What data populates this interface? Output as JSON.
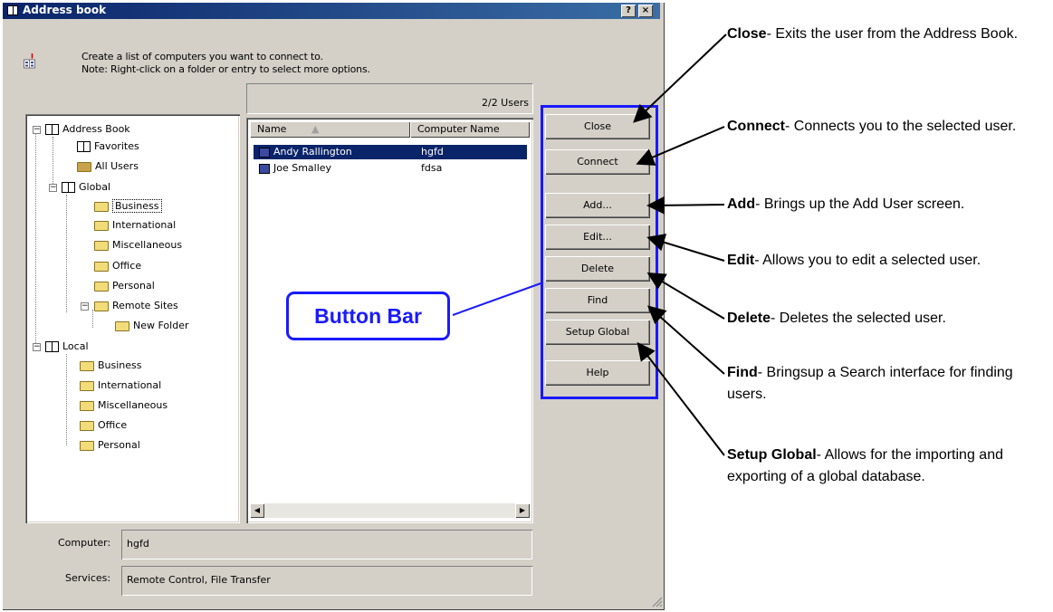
{
  "window": {
    "title": "Address book",
    "help_btn": "?",
    "close_btn": "×",
    "description_line1": "Create a list of computers you want to connect to.",
    "description_line2": "Note: Right-click on a folder or entry to select more options."
  },
  "tree": {
    "root": "Address Book",
    "favorites": "Favorites",
    "all_users": "All Users",
    "global": "Global",
    "global_children": [
      "Business",
      "International",
      "Miscellaneous",
      "Office",
      "Personal",
      "Remote Sites"
    ],
    "remote_new_folder": "New Folder",
    "local": "Local",
    "local_children": [
      "Business",
      "International",
      "Miscellaneous",
      "Office",
      "Personal"
    ]
  },
  "list": {
    "status": "2/2 Users",
    "col_name": "Name",
    "col_computer": "Computer Name",
    "rows": [
      {
        "name": "Andy Rallington",
        "computer": "hgfd",
        "selected": true
      },
      {
        "name": "Joe Smalley",
        "computer": "fdsa",
        "selected": false
      }
    ]
  },
  "buttons": {
    "close": "Close",
    "connect": "Connect",
    "add": "Add...",
    "edit": "Edit...",
    "delete": "Delete",
    "find": "Find",
    "setup_global": "Setup Global",
    "help": "Help"
  },
  "details": {
    "computer_label": "Computer:",
    "computer_value": "hgfd",
    "services_label": "Services:",
    "services_value": "Remote Control, File Transfer"
  },
  "callout": "Button Bar",
  "annotations": [
    {
      "term": "Close",
      "text": "- Exits the user from the Address Book."
    },
    {
      "term": "Connect",
      "text": "- Connects you to the selected user."
    },
    {
      "term": "Add",
      "text": "- Brings up the Add User screen."
    },
    {
      "term": "Edit",
      "text": "- Allows you to edit a selected user."
    },
    {
      "term": "Delete",
      "text": "- Deletes the selected user."
    },
    {
      "term": "Find",
      "text": "- Bringsup a Search interface for finding users."
    },
    {
      "term": "Setup Global",
      "text": "- Allows for the importing and exporting of a global database."
    }
  ],
  "colors": {
    "accent_blue": "#1a1aff",
    "selection": "#0a246a",
    "face": "#d4d0c8"
  }
}
